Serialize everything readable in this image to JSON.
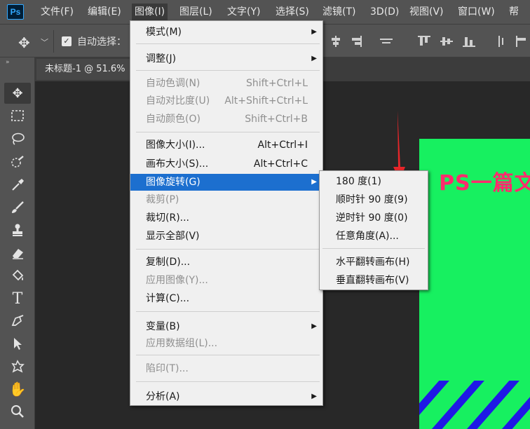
{
  "menubar": {
    "logo": "Ps",
    "items": [
      "文件(F)",
      "编辑(E)",
      "图像(I)",
      "图层(L)",
      "文字(Y)",
      "选择(S)",
      "滤镜(T)",
      "3D(D)",
      "视图(V)",
      "窗口(W)",
      "帮助"
    ],
    "active_index": 2
  },
  "options": {
    "auto_select_label": "自动选择："
  },
  "document": {
    "tab_title": "未标题-1 @ 51.6%",
    "canvas_text": "PS一篇文",
    "canvas_color": "#17f060",
    "text_color": "#ff2c6d",
    "stripe_color": "#1f18e6"
  },
  "image_menu": {
    "items": [
      {
        "label": "模式(M)",
        "shortcut": "",
        "submenu": true,
        "disabled": false
      },
      {
        "label": "调整(J)",
        "shortcut": "",
        "submenu": true,
        "disabled": false
      },
      {
        "label": "自动色调(N)",
        "shortcut": "Shift+Ctrl+L",
        "submenu": false,
        "disabled": true
      },
      {
        "label": "自动对比度(U)",
        "shortcut": "Alt+Shift+Ctrl+L",
        "submenu": false,
        "disabled": true
      },
      {
        "label": "自动颜色(O)",
        "shortcut": "Shift+Ctrl+B",
        "submenu": false,
        "disabled": true
      },
      {
        "label": "图像大小(I)...",
        "shortcut": "Alt+Ctrl+I",
        "submenu": false,
        "disabled": false
      },
      {
        "label": "画布大小(S)...",
        "shortcut": "Alt+Ctrl+C",
        "submenu": false,
        "disabled": false
      },
      {
        "label": "图像旋转(G)",
        "shortcut": "",
        "submenu": true,
        "disabled": false,
        "highlighted": true
      },
      {
        "label": "裁剪(P)",
        "shortcut": "",
        "submenu": false,
        "disabled": true
      },
      {
        "label": "裁切(R)...",
        "shortcut": "",
        "submenu": false,
        "disabled": false
      },
      {
        "label": "显示全部(V)",
        "shortcut": "",
        "submenu": false,
        "disabled": false
      },
      {
        "label": "复制(D)...",
        "shortcut": "",
        "submenu": false,
        "disabled": false
      },
      {
        "label": "应用图像(Y)...",
        "shortcut": "",
        "submenu": false,
        "disabled": true
      },
      {
        "label": "计算(C)...",
        "shortcut": "",
        "submenu": false,
        "disabled": false
      },
      {
        "label": "变量(B)",
        "shortcut": "",
        "submenu": true,
        "disabled": false
      },
      {
        "label": "应用数据组(L)...",
        "shortcut": "",
        "submenu": false,
        "disabled": true
      },
      {
        "label": "陷印(T)...",
        "shortcut": "",
        "submenu": false,
        "disabled": true
      },
      {
        "label": "分析(A)",
        "shortcut": "",
        "submenu": true,
        "disabled": false
      }
    ]
  },
  "rotate_submenu": {
    "items": [
      "180 度(1)",
      "顺时针 90 度(9)",
      "逆时针 90 度(0)",
      "任意角度(A)...",
      "水平翻转画布(H)",
      "垂直翻转画布(V)"
    ]
  },
  "tools": [
    "move-tool",
    "marquee-tool",
    "lasso-tool",
    "quick-select-tool",
    "eyedropper-tool",
    "brush-tool",
    "stamp-tool",
    "eraser-tool",
    "paint-bucket-tool",
    "type-tool",
    "pen-tool",
    "path-select-tool",
    "shape-tool",
    "hand-tool",
    "zoom-tool"
  ],
  "colors": {
    "highlight": "#1c6fcf",
    "menu_bg": "#f0f0f0",
    "arrow": "#e8262a"
  }
}
